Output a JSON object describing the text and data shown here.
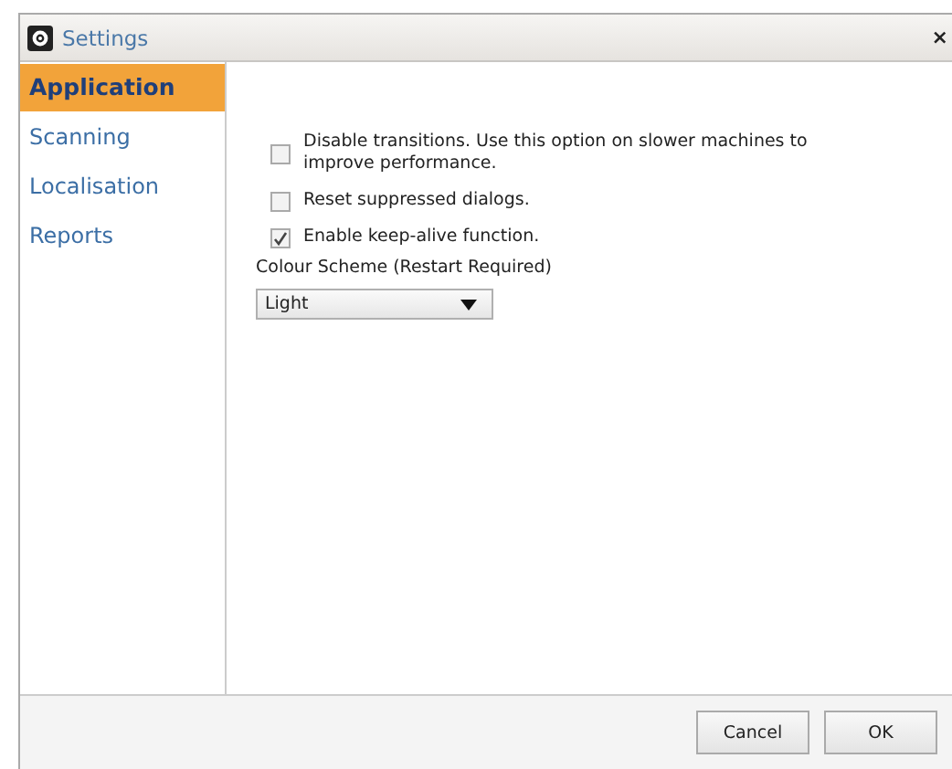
{
  "window": {
    "title": "Settings",
    "close": "×"
  },
  "sidebar": {
    "items": [
      {
        "label": "Application",
        "selected": true
      },
      {
        "label": "Scanning",
        "selected": false
      },
      {
        "label": "Localisation",
        "selected": false
      },
      {
        "label": "Reports",
        "selected": false
      }
    ]
  },
  "options": [
    {
      "label": "Disable transitions.  Use this option on slower machines to improve performance.",
      "checked": false
    },
    {
      "label": "Reset suppressed dialogs.",
      "checked": false
    },
    {
      "label": "Enable keep-alive function.",
      "checked": true
    }
  ],
  "colour_scheme": {
    "label": "Colour Scheme (Restart Required)",
    "value": "Light"
  },
  "buttons": [
    "Cancel",
    "OK"
  ]
}
